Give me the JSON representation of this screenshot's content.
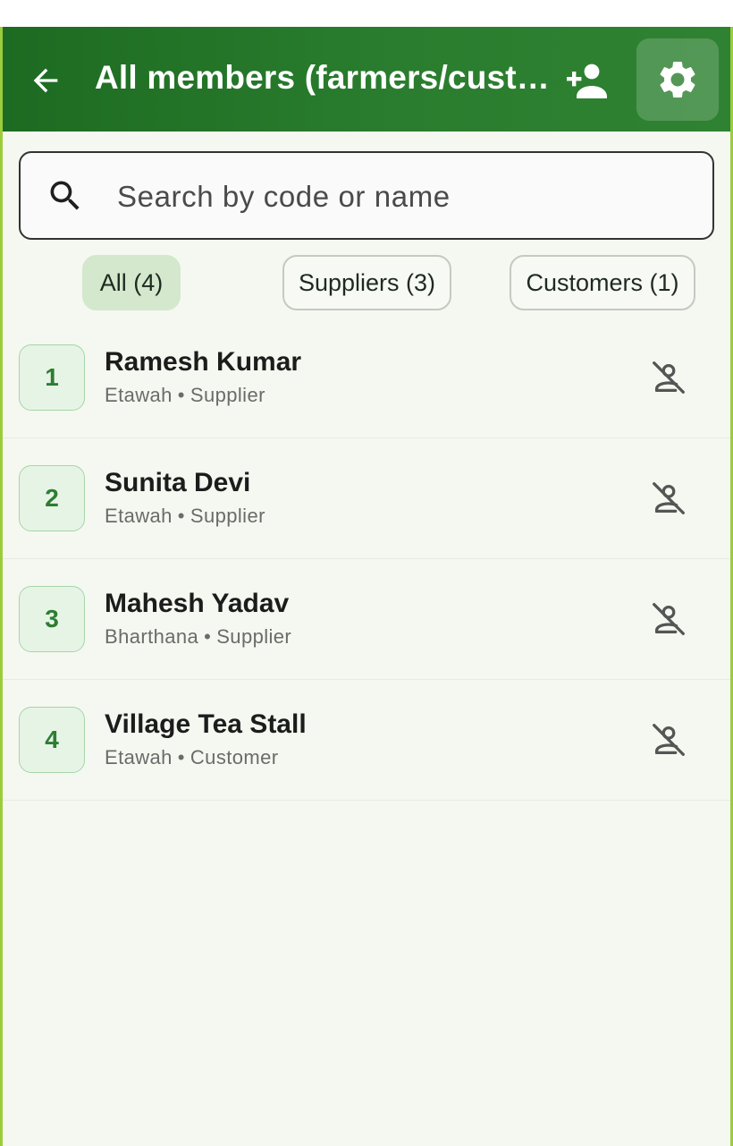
{
  "appbar": {
    "title": "All members (farmers/cust…",
    "back_icon": "arrow-back-icon",
    "add_icon": "person-add-icon",
    "settings_icon": "gear-icon",
    "color": "#2a7d2e"
  },
  "search": {
    "placeholder": "Search by code or name",
    "value": ""
  },
  "filters": [
    {
      "label": "All (4)",
      "selected": true
    },
    {
      "label": "Suppliers (3)",
      "selected": false
    },
    {
      "label": "Customers (1)",
      "selected": false
    }
  ],
  "members": [
    {
      "code": "1",
      "name": "Ramesh Kumar",
      "place": "Etawah",
      "role": "Supplier",
      "icon": "no-account-icon"
    },
    {
      "code": "2",
      "name": "Sunita Devi",
      "place": "Etawah",
      "role": "Supplier",
      "icon": "no-account-icon"
    },
    {
      "code": "3",
      "name": "Mahesh Yadav",
      "place": "Bharthana",
      "role": "Supplier",
      "icon": "no-account-icon"
    },
    {
      "code": "4",
      "name": "Village Tea Stall",
      "place": "Etawah",
      "role": "Customer",
      "icon": "no-account-icon"
    }
  ],
  "separator": "•"
}
